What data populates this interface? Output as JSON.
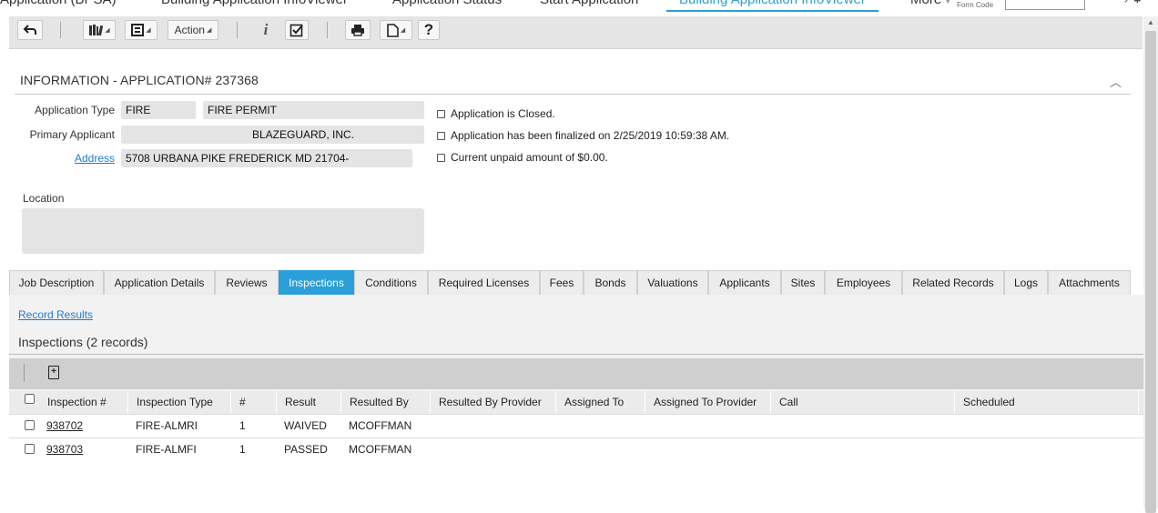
{
  "top_nav": {
    "tabs": [
      "Application (BPSA)",
      "Building Application InfoViewer",
      "Application Status",
      "Start Application",
      "Building Application InfoViewer",
      "More"
    ],
    "active_index": 4,
    "form_code_label": "Form Code",
    "form_code_value": ""
  },
  "toolbar": {
    "action_label": "Action",
    "icons": [
      "back-arrow-icon",
      "library-icon",
      "report-icon",
      "info-icon",
      "checkbox-icon",
      "print-icon",
      "document-icon",
      "help-icon"
    ]
  },
  "info": {
    "title": "INFORMATION - APPLICATION# 237368",
    "application_type_label": "Application Type",
    "application_type_code": "FIRE",
    "application_type_name": "FIRE PERMIT",
    "primary_applicant_label": "Primary Applicant",
    "primary_applicant_value": "BLAZEGUARD, INC.",
    "address_label": "Address",
    "address_value": "5708 URBANA PIKE FREDERICK MD 21704-",
    "location_label": "Location",
    "location_value": "",
    "notices": [
      "Application is Closed.",
      "Application has been finalized on 2/25/2019 10:59:38 AM.",
      "Current unpaid amount of $0.00."
    ]
  },
  "tabs": {
    "items": [
      "Job Description",
      "Application Details",
      "Reviews",
      "Inspections",
      "Conditions",
      "Required Licenses",
      "Fees",
      "Bonds",
      "Valuations",
      "Applicants",
      "Sites",
      "Employees",
      "Related Records",
      "Logs",
      "Attachments"
    ],
    "active_index": 3
  },
  "inspections": {
    "record_results_link": "Record Results",
    "title": "Inspections (2 records)",
    "columns": [
      "Inspection #",
      "Inspection Type",
      "#",
      "Result",
      "Resulted By",
      "Resulted By Provider",
      "Assigned To",
      "Assigned To Provider",
      "Call",
      "Scheduled"
    ],
    "rows": [
      {
        "inspection_no": "938702",
        "type": "FIRE-ALMRI",
        "num": "1",
        "result": "WAIVED",
        "resulted_by": "MCOFFMAN",
        "provider": "",
        "assigned_to": "",
        "assigned_provider": "",
        "call": "",
        "scheduled": ""
      },
      {
        "inspection_no": "938703",
        "type": "FIRE-ALMFI",
        "num": "1",
        "result": "PASSED",
        "resulted_by": "MCOFFMAN",
        "provider": "",
        "assigned_to": "",
        "assigned_provider": "",
        "call": "",
        "scheduled": ""
      }
    ]
  }
}
